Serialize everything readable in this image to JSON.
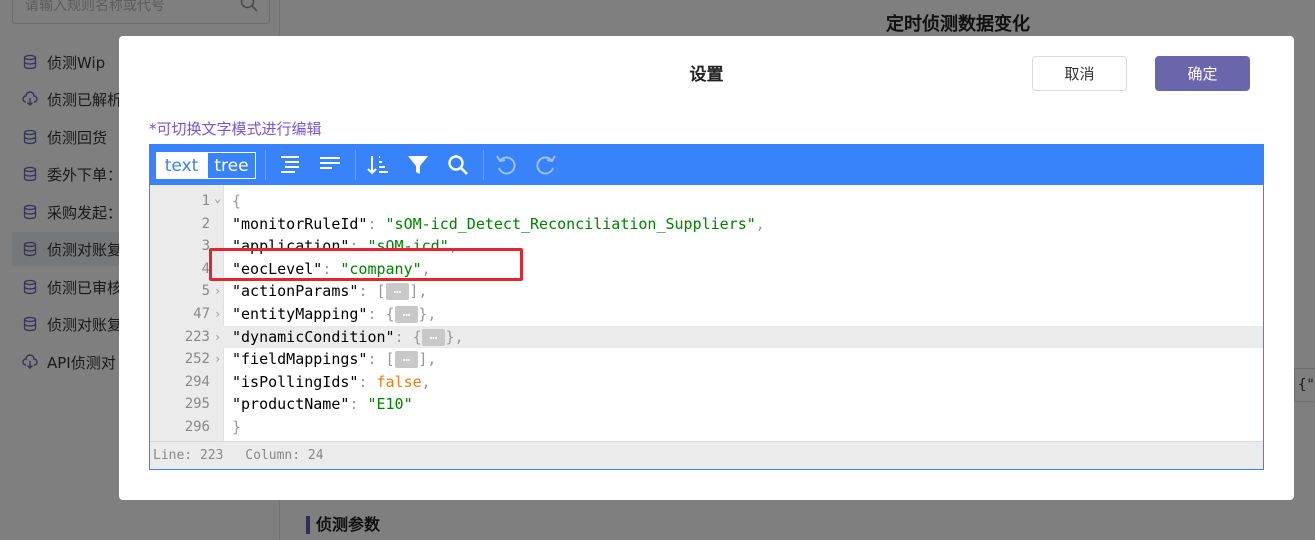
{
  "background": {
    "search_placeholder": "请输入规则名称或代号",
    "sidebar_items": [
      {
        "label": "侦测Wip",
        "icon": "database-icon"
      },
      {
        "label": "侦测已解析",
        "icon": "cloud-download-icon"
      },
      {
        "label": "侦测回货",
        "icon": "database-icon"
      },
      {
        "label": "委外下单：",
        "icon": "database-icon"
      },
      {
        "label": "采购发起：",
        "icon": "database-icon"
      },
      {
        "label": "侦测对账复",
        "icon": "database-icon"
      },
      {
        "label": "侦测已审核",
        "icon": "database-icon"
      },
      {
        "label": "侦测对账复",
        "icon": "database-icon"
      },
      {
        "label": "API侦测对",
        "icon": "cloud-download-icon"
      }
    ],
    "active_index": 5,
    "page_title": "定时侦测数据变化",
    "section_title": "侦测参数",
    "right_box_text": "{\"n"
  },
  "modal": {
    "title": "设置",
    "cancel_label": "取消",
    "ok_label": "确定",
    "hint": "*可切换文字模式进行编辑"
  },
  "editor": {
    "mode_text": "text",
    "mode_tree": "tree",
    "toolbar_icons": [
      "format-icon",
      "compact-icon",
      "sort-icon",
      "filter-icon",
      "search-icon",
      "undo-icon",
      "redo-icon"
    ],
    "lines": [
      {
        "no": "1",
        "fold": "⌄",
        "text": "{"
      },
      {
        "no": "2",
        "key": "\"monitorRuleId\"",
        "value": "\"sOM-icd_Detect_Reconciliation_Suppliers\"",
        "vtype": "string",
        "comma": ","
      },
      {
        "no": "3",
        "key": "\"application\"",
        "value": "\"sOM-icd\"",
        "vtype": "string",
        "comma": ","
      },
      {
        "no": "4",
        "key": "\"eocLevel\"",
        "value": "\"company\"",
        "vtype": "string",
        "comma": ","
      },
      {
        "no": "5",
        "fold": "›",
        "key": "\"actionParams\"",
        "open": "[",
        "close": "]",
        "comma": ","
      },
      {
        "no": "47",
        "fold": "›",
        "key": "\"entityMapping\"",
        "open": "{",
        "close": "}",
        "comma": ","
      },
      {
        "no": "223",
        "fold": "›",
        "key": "\"dynamicCondition\"",
        "open": "{",
        "close": "}",
        "comma": ",",
        "highlight": true
      },
      {
        "no": "252",
        "fold": "›",
        "key": "\"fieldMappings\"",
        "open": "[",
        "close": "]",
        "comma": ","
      },
      {
        "no": "294",
        "key": "\"isPollingIds\"",
        "value": "false",
        "vtype": "bool",
        "comma": ","
      },
      {
        "no": "295",
        "key": "\"productName\"",
        "value": "\"E10\"",
        "vtype": "string",
        "comma": ""
      },
      {
        "no": "296",
        "text": "}"
      }
    ],
    "collapsed_marker": "…",
    "status_line": "Line: 223",
    "status_column": "Column: 24"
  },
  "colors": {
    "accent": "#3883fa",
    "primary_button": "#6a66ad",
    "hint": "#7a55d8",
    "annotation": "#e3262c"
  }
}
